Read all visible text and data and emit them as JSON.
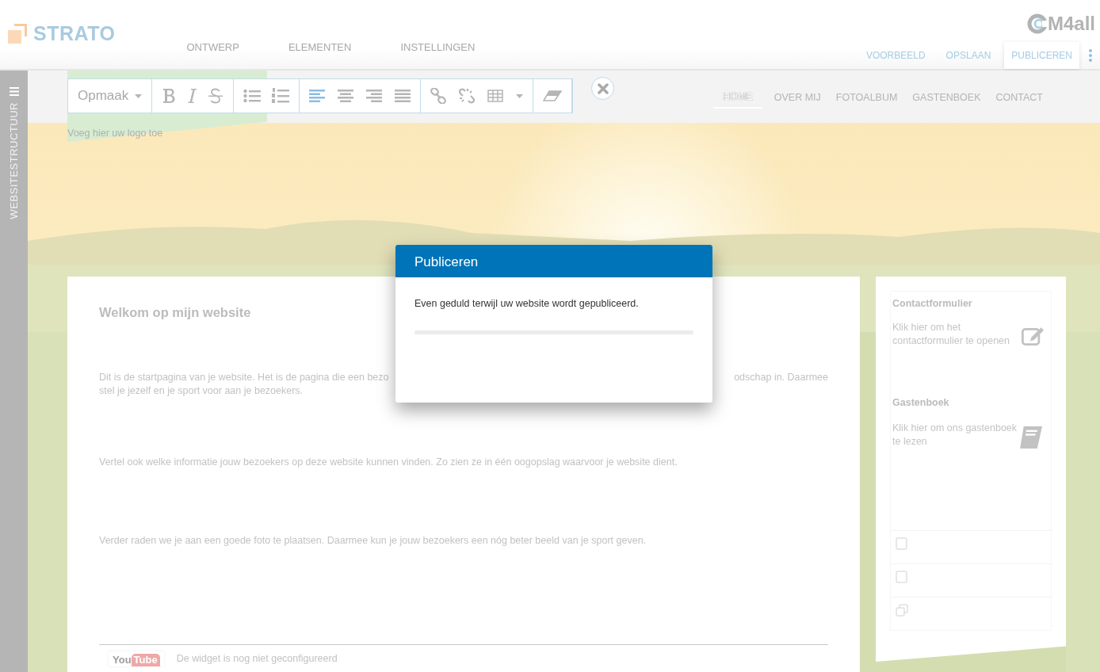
{
  "header": {
    "brand": "STRATO",
    "tabs": [
      {
        "label": "ONTWERP"
      },
      {
        "label": "ELEMENTEN"
      },
      {
        "label": "INSTELLINGEN"
      }
    ],
    "vendor": "M4all",
    "actions": [
      {
        "label": "VOORBEELD",
        "selected": false
      },
      {
        "label": "OPSLAAN",
        "selected": false
      },
      {
        "label": "PUBLICEREN",
        "selected": true
      }
    ]
  },
  "sidebar": {
    "label": "WEBSITESTRUCTUUR"
  },
  "toolbar": {
    "format": "Opmaak",
    "align": [
      {
        "kind": "left",
        "selected": true
      },
      {
        "kind": "center",
        "selected": false
      },
      {
        "kind": "right",
        "selected": false
      },
      {
        "kind": "justify",
        "selected": false
      }
    ]
  },
  "site": {
    "logo_hint": "Voeg hier uw logo toe",
    "nav": [
      {
        "label": "HOME",
        "selected": true
      },
      {
        "label": "OVER MIJ",
        "selected": false
      },
      {
        "label": "FOTOALBUM",
        "selected": false
      },
      {
        "label": "GASTENBOEK",
        "selected": false
      },
      {
        "label": "CONTACT",
        "selected": false
      }
    ],
    "heading": "Welkom op mijn website",
    "intro": {
      "left": "Dit is de startpagina van je website. Het is de pagina die een bezo",
      "right": "odschap in. Daarmee",
      "continuation": "stel je jezelf en je sport voor aan je bezoekers."
    },
    "paragraphs": [
      "Vertel ook welke informatie jouw bezoekers op deze website kunnen vinden. Zo zien ze in één oogopslag waarvoor je website dient.",
      "Verder raden we je aan een goede foto te plaatsen. Daarmee kun je jouw bezoekers een nóg beter beeld van je sport geven."
    ],
    "widget": {
      "logo": [
        "You",
        "Tube"
      ],
      "text": "De widget is nog niet geconfigureerd"
    },
    "aside": [
      {
        "kind": "contact",
        "title": "Contactformulier",
        "text": "Klik hier om het contactformulier te openen"
      },
      {
        "kind": "guestbook",
        "title": "Gastenboek",
        "text": "Klik hier om ons gastenboek te lezen"
      }
    ]
  },
  "dialog": {
    "title": "Publiceren",
    "message": "Even geduld terwijl uw website wordt gepubliceerd.",
    "level": 0
  }
}
